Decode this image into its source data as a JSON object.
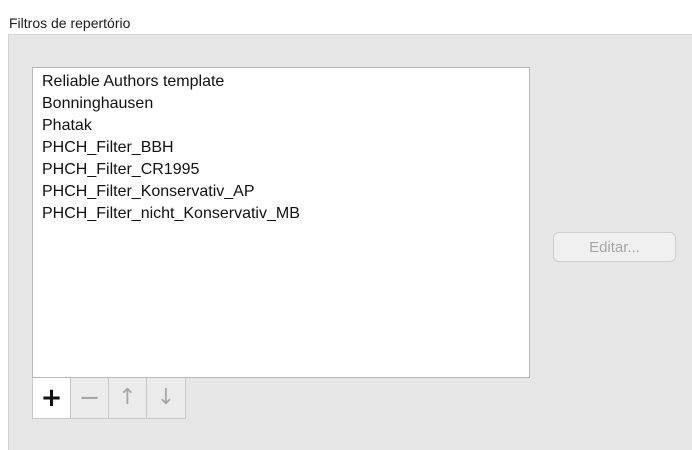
{
  "section": {
    "title": "Filtros de repertório"
  },
  "filter_list": {
    "items": [
      "Reliable Authors template",
      "Bonninghausen",
      "Phatak",
      "PHCH_Filter_BBH",
      "PHCH_Filter_CR1995",
      "PHCH_Filter_Konservativ_AP",
      "PHCH_Filter_nicht_Konservativ_MB"
    ]
  },
  "toolbar": {
    "add_glyph": "+",
    "remove_glyph": "−",
    "move_up_glyph": "↑",
    "move_down_glyph": "↓",
    "add_icon": "plus-icon",
    "remove_icon": "minus-icon",
    "move_up_icon": "arrow-up-icon",
    "move_down_icon": "arrow-down-icon"
  },
  "edit_button": {
    "label": "Editar..."
  },
  "colors": {
    "panel_background": "#e6e6e6",
    "list_background": "#ffffff",
    "disabled_text": "#a6a6a6"
  }
}
